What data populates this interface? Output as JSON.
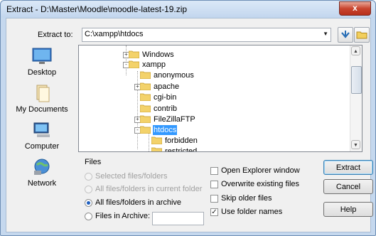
{
  "window": {
    "title": "Extract - D:\\Master\\Moodle\\moodle-latest-19.zip",
    "close_label": "x"
  },
  "extract_to": {
    "label": "Extract to:",
    "value": "C:\\xampp\\htdocs"
  },
  "places": [
    {
      "label": "Desktop",
      "icon": "desktop-icon"
    },
    {
      "label": "My Documents",
      "icon": "documents-icon"
    },
    {
      "label": "Computer",
      "icon": "computer-icon"
    },
    {
      "label": "Network",
      "icon": "network-icon"
    }
  ],
  "tree": [
    {
      "label": "Windows",
      "expander": "+"
    },
    {
      "label": "xampp",
      "expander": "-"
    },
    {
      "label": "anonymous",
      "expander": ""
    },
    {
      "label": "apache",
      "expander": "+"
    },
    {
      "label": "cgi-bin",
      "expander": ""
    },
    {
      "label": "contrib",
      "expander": ""
    },
    {
      "label": "FileZillaFTP",
      "expander": "+"
    },
    {
      "label": "htdocs",
      "expander": "-",
      "selected": true
    },
    {
      "label": "forbidden",
      "expander": ""
    },
    {
      "label": "restricted",
      "expander": ""
    }
  ],
  "files_group": {
    "title": "Files",
    "options": [
      {
        "label": "Selected files/folders",
        "enabled": false,
        "checked": false
      },
      {
        "label": "All files/folders in current folder",
        "enabled": false,
        "checked": false
      },
      {
        "label": "All files/folders in archive",
        "enabled": true,
        "checked": true
      },
      {
        "label": "Files in Archive:",
        "enabled": true,
        "checked": false
      }
    ],
    "archive_filter_value": ""
  },
  "options": [
    {
      "label": "Open Explorer window",
      "checked": false
    },
    {
      "label": "Overwrite existing files",
      "checked": false
    },
    {
      "label": "Skip older files",
      "checked": false
    },
    {
      "label": "Use folder names",
      "checked": true
    }
  ],
  "buttons": {
    "extract": "Extract",
    "cancel": "Cancel",
    "help": "Help"
  },
  "colors": {
    "selection": "#3399ff",
    "close_button": "#c9452f",
    "frame": "#c5d8ee"
  }
}
